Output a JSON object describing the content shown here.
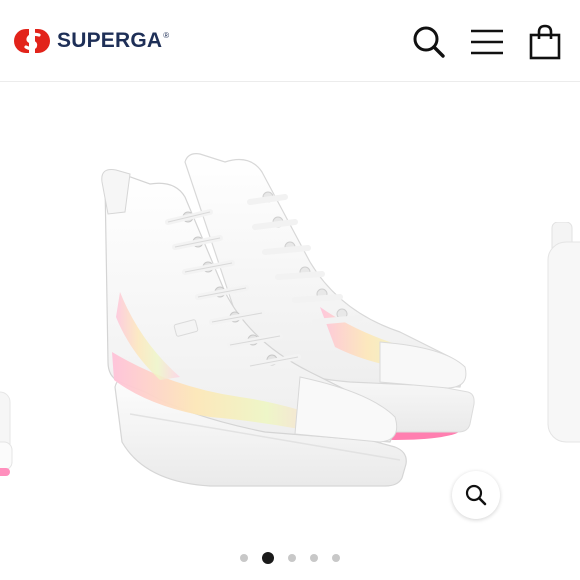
{
  "header": {
    "brand": "SUPERGA",
    "brand_mark": "®",
    "logo_icon": "superga-s-logo",
    "actions": [
      {
        "name": "search-icon"
      },
      {
        "name": "menu-icon"
      },
      {
        "name": "cart-icon"
      }
    ]
  },
  "gallery": {
    "product_image": "white-high-top-platform-sneakers-with-pastel-gradient",
    "zoom_icon": "zoom-in-icon",
    "slide_count": 5,
    "active_slide": 2
  },
  "colors": {
    "brand_navy": "#1e2f57",
    "brand_red": "#e2231a",
    "icon_dark": "#111111",
    "dot_inactive": "#c8c8c8",
    "dot_active": "#1a1a1a",
    "sole_pink": "#ff7fb0"
  }
}
